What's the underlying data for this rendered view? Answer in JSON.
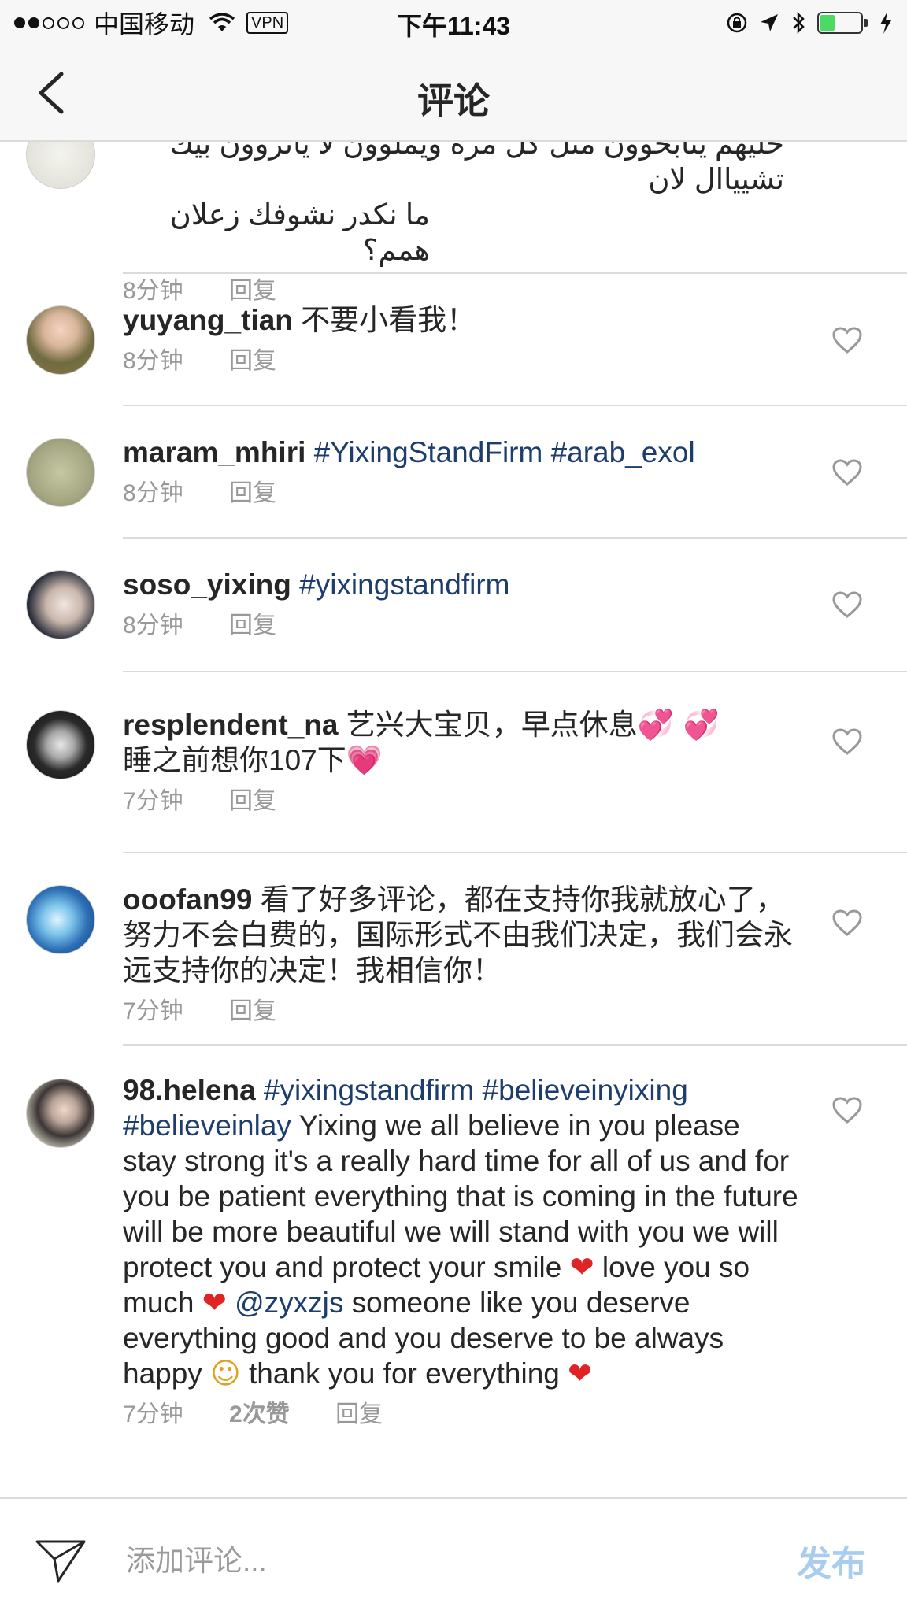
{
  "status_bar": {
    "carrier": "中国移动",
    "vpn": "VPN",
    "time": "下午11:43",
    "battery_level": 0.35
  },
  "nav": {
    "title": "评论"
  },
  "comments": [
    {
      "text_line1": "خليهم ينابحوون مثل كل مرة ويملوون لا ياتروون بيك تشيياال لان",
      "text_line2": "ما نكدر نشوفك زعلان همم؟",
      "time": "8分钟",
      "reply": "回复"
    },
    {
      "username": "yuyang_tian",
      "text": " 不要小看我！",
      "time": "8分钟",
      "reply": "回复"
    },
    {
      "username": "maram_mhiri",
      "hashtags": " #YixingStandFirm #arab_exol",
      "time": "8分钟",
      "reply": "回复"
    },
    {
      "username": "soso_yixing",
      "hashtags": " #yixingstandfirm",
      "time": "8分钟",
      "reply": "回复"
    },
    {
      "username": "resplendent_na",
      "text_line1": " 艺兴大宝贝，早点休息",
      "text_line2": "睡之前想你107下",
      "time": "7分钟",
      "reply": "回复"
    },
    {
      "username": "ooofan99",
      "text": " 看了好多评论，都在支持你我就放心了，努力不会白费的，国际形式不由我们决定，我们会永远支持你的决定！我相信你！",
      "time": "7分钟",
      "reply": "回复"
    },
    {
      "username": "98.helena",
      "hashtags1": " #yixingstandfirm #believeinyixing",
      "hashtags2": "#believeinlay",
      "text1": " Yixing we all believe in you please stay strong it's a really hard time for all of us and for you be patient everything that is coming in the future will be more beautiful we will stand with you we will protect you and protect your smile ",
      "text2": " love you so much ",
      "mention": "@zyxzjs",
      "text3": " someone like you deserve everything good and you deserve to be always happy ",
      "text4": " thank you for everything ",
      "time": "7分钟",
      "likes": "2次赞",
      "reply": "回复"
    }
  ],
  "composer": {
    "placeholder": "添加评论...",
    "post": "发布"
  }
}
